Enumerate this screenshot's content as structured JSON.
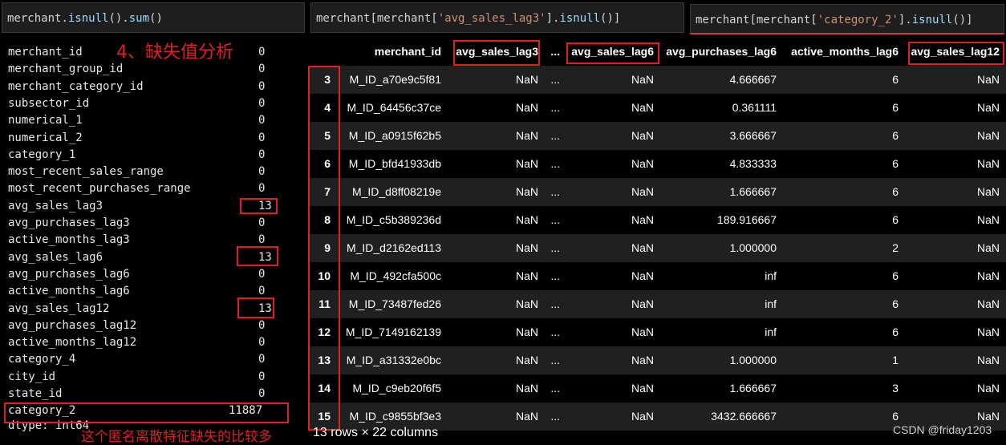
{
  "cells": {
    "c1": {
      "obj": "merchant",
      "d1": ".",
      "fn1": "isnull",
      "p1": "().",
      "fn2": "sum",
      "p2": "()"
    },
    "c2": {
      "obj": "merchant",
      "b1": "[merchant[",
      "str": "'avg_sales_lag3'",
      "b2": "].",
      "fn": "isnull",
      "p": "()]"
    },
    "c3": {
      "obj": "merchant",
      "b1": "[merchant[",
      "str": "'category_2'",
      "b2": "].",
      "fn": "isnull",
      "p": "()]"
    }
  },
  "annotations": {
    "title": "4、缺失值分析",
    "note": "这个匿名离散特征缺失的比较多"
  },
  "series": [
    {
      "name": "merchant_id",
      "value": "0"
    },
    {
      "name": "merchant_group_id",
      "value": "0"
    },
    {
      "name": "merchant_category_id",
      "value": "0"
    },
    {
      "name": "subsector_id",
      "value": "0"
    },
    {
      "name": "numerical_1",
      "value": "0"
    },
    {
      "name": "numerical_2",
      "value": "0"
    },
    {
      "name": "category_1",
      "value": "0"
    },
    {
      "name": "most_recent_sales_range",
      "value": "0"
    },
    {
      "name": "most_recent_purchases_range",
      "value": "0"
    },
    {
      "name": "avg_sales_lag3",
      "value": "13"
    },
    {
      "name": "avg_purchases_lag3",
      "value": "0"
    },
    {
      "name": "active_months_lag3",
      "value": "0"
    },
    {
      "name": "avg_sales_lag6",
      "value": "13"
    },
    {
      "name": "avg_purchases_lag6",
      "value": "0"
    },
    {
      "name": "active_months_lag6",
      "value": "0"
    },
    {
      "name": "avg_sales_lag12",
      "value": "13"
    },
    {
      "name": "avg_purchases_lag12",
      "value": "0"
    },
    {
      "name": "active_months_lag12",
      "value": "0"
    },
    {
      "name": "category_4",
      "value": "0"
    },
    {
      "name": "city_id",
      "value": "0"
    },
    {
      "name": "state_id",
      "value": "0"
    },
    {
      "name": "category_2",
      "value": "11887"
    }
  ],
  "dtype": "dtype: int64",
  "table": {
    "headers": [
      "merchant_id",
      "avg_sales_lag3",
      "...",
      "avg_sales_lag6",
      "avg_purchases_lag6",
      "active_months_lag6",
      "avg_sales_lag12"
    ],
    "rows": [
      [
        "3",
        "M_ID_a70e9c5f81",
        "NaN",
        "...",
        "NaN",
        "4.666667",
        "6",
        "NaN"
      ],
      [
        "4",
        "M_ID_64456c37ce",
        "NaN",
        "...",
        "NaN",
        "0.361111",
        "6",
        "NaN"
      ],
      [
        "5",
        "M_ID_a0915f62b5",
        "NaN",
        "...",
        "NaN",
        "3.666667",
        "6",
        "NaN"
      ],
      [
        "6",
        "M_ID_bfd41933db",
        "NaN",
        "...",
        "NaN",
        "4.833333",
        "6",
        "NaN"
      ],
      [
        "7",
        "M_ID_d8ff08219e",
        "NaN",
        "...",
        "NaN",
        "1.666667",
        "6",
        "NaN"
      ],
      [
        "8",
        "M_ID_c5b389236d",
        "NaN",
        "...",
        "NaN",
        "189.916667",
        "6",
        "NaN"
      ],
      [
        "9",
        "M_ID_d2162ed113",
        "NaN",
        "...",
        "NaN",
        "1.000000",
        "2",
        "NaN"
      ],
      [
        "10",
        "M_ID_492cfa500c",
        "NaN",
        "...",
        "NaN",
        "inf",
        "6",
        "NaN"
      ],
      [
        "11",
        "M_ID_73487fed26",
        "NaN",
        "...",
        "NaN",
        "inf",
        "6",
        "NaN"
      ],
      [
        "12",
        "M_ID_7149162139",
        "NaN",
        "...",
        "NaN",
        "inf",
        "6",
        "NaN"
      ],
      [
        "13",
        "M_ID_a31332e0bc",
        "NaN",
        "...",
        "NaN",
        "1.000000",
        "1",
        "NaN"
      ],
      [
        "14",
        "M_ID_c9eb20f6f5",
        "NaN",
        "...",
        "NaN",
        "1.666667",
        "3",
        "NaN"
      ],
      [
        "15",
        "M_ID_c9855bf3e3",
        "NaN",
        "...",
        "NaN",
        "3432.666667",
        "6",
        "NaN"
      ]
    ],
    "footer": "13 rows × 22 columns"
  },
  "watermark": "CSDN @friday1203",
  "colors": {
    "highlight": "#e02020",
    "string": "#ce9178",
    "function": "#9cdcfe",
    "active_cell_underline": "#e0304a"
  }
}
